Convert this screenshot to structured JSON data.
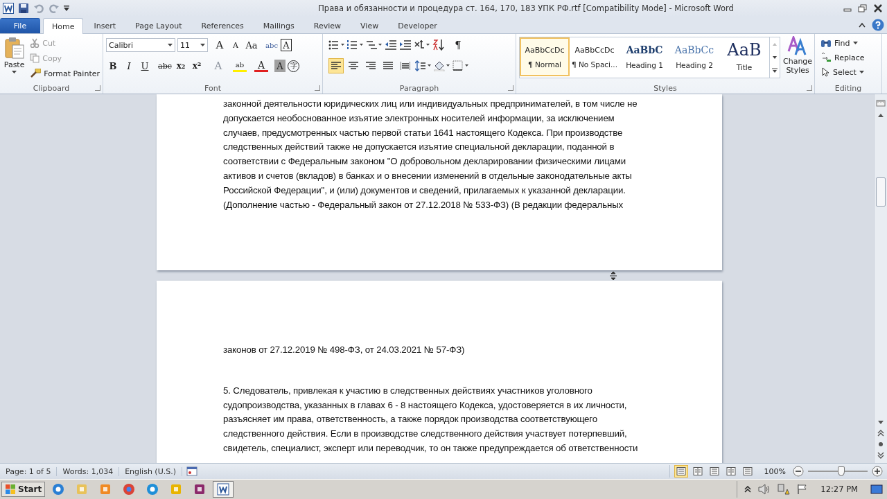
{
  "window": {
    "title": "Права и обязанности и процедура ст. 164, 170, 183 УПК РФ.rtf [Compatibility Mode]  -  Microsoft Word"
  },
  "tabs": [
    {
      "label": "File",
      "kind": "file",
      "selected": false
    },
    {
      "label": "Home",
      "kind": "tab",
      "selected": true
    },
    {
      "label": "Insert",
      "kind": "tab",
      "selected": false
    },
    {
      "label": "Page Layout",
      "kind": "tab",
      "selected": false
    },
    {
      "label": "References",
      "kind": "tab",
      "selected": false
    },
    {
      "label": "Mailings",
      "kind": "tab",
      "selected": false
    },
    {
      "label": "Review",
      "kind": "tab",
      "selected": false
    },
    {
      "label": "View",
      "kind": "tab",
      "selected": false
    },
    {
      "label": "Developer",
      "kind": "tab",
      "selected": false
    }
  ],
  "clipboard": {
    "group": "Clipboard",
    "paste": "Paste",
    "items": [
      {
        "label": "Cut",
        "kind": "cut",
        "disabled": true
      },
      {
        "label": "Copy",
        "kind": "copy",
        "disabled": true
      },
      {
        "label": "Format Painter",
        "kind": "painter",
        "disabled": false
      }
    ]
  },
  "font": {
    "group": "Font",
    "name": "Calibri",
    "size": "11",
    "row1": [
      {
        "label": "A",
        "kind": "grow"
      },
      {
        "label": "A",
        "kind": "shrink"
      },
      {
        "label": "Aa",
        "kind": "case"
      },
      {
        "label": "abc",
        "kind": "phonetic"
      },
      {
        "label": "A",
        "kind": "border"
      }
    ],
    "row2": [
      {
        "label": "B",
        "kind": "bold"
      },
      {
        "label": "I",
        "kind": "italic"
      },
      {
        "label": "U",
        "kind": "underline"
      },
      {
        "label": "abc",
        "kind": "strike"
      },
      {
        "label": "x₂",
        "kind": "sub"
      },
      {
        "label": "x²",
        "kind": "sup"
      },
      {
        "label": "A",
        "kind": "effects"
      },
      {
        "label": "ab",
        "kind": "highlight"
      },
      {
        "label": "A",
        "kind": "color"
      },
      {
        "label": "A",
        "kind": "shading"
      },
      {
        "label": "字",
        "kind": "enclose"
      }
    ]
  },
  "paragraph": {
    "group": "Paragraph",
    "align": [
      {
        "kind": "left",
        "selected": true
      },
      {
        "kind": "center",
        "selected": false
      },
      {
        "kind": "right",
        "selected": false
      },
      {
        "kind": "justify",
        "selected": false
      },
      {
        "kind": "distributed",
        "selected": false
      }
    ],
    "pilcrow": "¶"
  },
  "styles": {
    "group": "Styles",
    "items": [
      {
        "preview": "AaBbCcDc",
        "name": "¶ Normal",
        "kind": "normal",
        "selected": true
      },
      {
        "preview": "AaBbCcDc",
        "name": "¶ No Spaci...",
        "kind": "normal",
        "selected": false
      },
      {
        "preview": "AaBbC",
        "name": "Heading 1",
        "kind": "h1",
        "selected": false
      },
      {
        "preview": "AaBbCc",
        "name": "Heading 2",
        "kind": "h2",
        "selected": false
      },
      {
        "preview": "AaB",
        "name": "Title",
        "kind": "title",
        "selected": false
      }
    ],
    "change": "Change Styles"
  },
  "editing": {
    "group": "Editing",
    "items": [
      {
        "label": "Find",
        "kind": "find"
      },
      {
        "label": "Replace",
        "kind": "replace"
      },
      {
        "label": "Select",
        "kind": "select"
      }
    ]
  },
  "pages": [
    {
      "lines": [
        "законной деятельности юридических лиц или индивидуальных предпринимателей, в том числе не",
        "допускается необоснованное изъятие электронных носителей информации, за исключением",
        "случаев, предусмотренных частью первой статьи 1641  настоящего Кодекса. При производстве",
        "следственных действий также не допускается изъятие специальной декларации, поданной в",
        "соответствии с Федеральным законом \"О добровольном декларировании физическими лицами",
        "активов и счетов (вкладов) в банках и о внесении изменений в отдельные законодательные акты",
        "Российской Федерации\", и (или) документов и сведений, прилагаемых к указанной декларации.",
        "(Дополнение частью - Федеральный закон от 27.12.2018  № 533-ФЗ) (В редакции федеральных"
      ]
    },
    {
      "lines": [
        "законов от 27.12.2019  № 498-ФЗ, от 24.03.2021  № 57-ФЗ)"
      ],
      "paragraph": [
        "5. Следователь, привлекая к участию в следственных действиях участников уголовного",
        "судопроизводства, указанных в главах 6  - 8  настоящего Кодекса, удостоверяется в их личности,",
        "разъясняет им права, ответственность, а также порядок производства соответствующего",
        "следственного действия. Если в производстве следственного действия участвует потерпевший,",
        "свидетель, специалист, эксперт или переводчик, то он также предупреждается об ответственности"
      ]
    }
  ],
  "status_bar": {
    "items": [
      "Page: 1 of 5",
      "Words: 1,034",
      "English (U.S.)"
    ],
    "views": [
      {
        "selected": true
      },
      {
        "selected": false
      },
      {
        "selected": false
      },
      {
        "selected": false
      },
      {
        "selected": false
      }
    ],
    "zoom": "100%",
    "zoom_level": {
      "level": 0.56
    }
  },
  "taskbar": {
    "start": "Start",
    "apps": [
      {
        "kind": "ie",
        "selected": false
      },
      {
        "kind": "folder",
        "selected": false
      },
      {
        "kind": "media",
        "selected": false
      },
      {
        "kind": "chrome",
        "selected": false
      },
      {
        "kind": "edge",
        "selected": false
      },
      {
        "kind": "outlook",
        "selected": false
      },
      {
        "kind": "winrar",
        "selected": false
      },
      {
        "kind": "word",
        "selected": true
      }
    ],
    "time": "12:27 PM"
  }
}
